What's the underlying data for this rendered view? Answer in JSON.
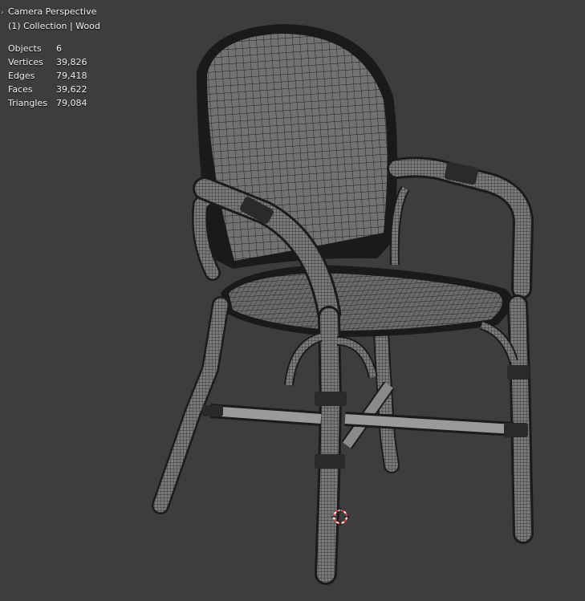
{
  "viewport": {
    "view_name": "Camera Perspective",
    "collection_label": "(1) Collection | Wood",
    "stats": [
      {
        "label": "Objects",
        "value": "6"
      },
      {
        "label": "Vertices",
        "value": "39,826"
      },
      {
        "label": "Edges",
        "value": "79,418"
      },
      {
        "label": "Faces",
        "value": "39,622"
      },
      {
        "label": "Triangles",
        "value": "79,084"
      }
    ]
  },
  "colors": {
    "background": "#3d3d3d",
    "mesh_fill": "#6f6f6f",
    "wire": "#1a1a1a",
    "cursor_red": "#e03b3b"
  },
  "icons": [
    "expand-arrow-icon",
    "3d-cursor-icon"
  ]
}
